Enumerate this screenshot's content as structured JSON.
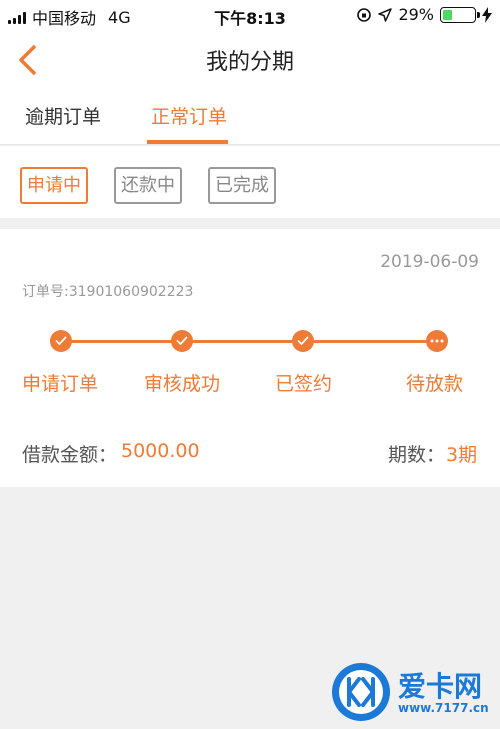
{
  "status_bar": {
    "carrier": "中国移动",
    "network": "4G",
    "time": "下午8:13",
    "battery_percent": "29%",
    "battery_level": 0.29,
    "battery_color": "#4cd964"
  },
  "nav": {
    "title": "我的分期",
    "back_icon": "chevron-left-icon"
  },
  "tabs": [
    {
      "label": "逾期订单",
      "active": false
    },
    {
      "label": "正常订单",
      "active": true
    }
  ],
  "filters": [
    {
      "label": "申请中",
      "active": true
    },
    {
      "label": "还款中",
      "active": false
    },
    {
      "label": "已完成",
      "active": false
    }
  ],
  "order": {
    "date": "2019-06-09",
    "order_no": "订单号:31901060902223",
    "steps": [
      {
        "label": "申请订单",
        "icon": "check-icon"
      },
      {
        "label": "审核成功",
        "icon": "check-icon"
      },
      {
        "label": "已签约",
        "icon": "check-icon"
      },
      {
        "label": "待放款",
        "icon": "more-dots-icon"
      }
    ],
    "amount_label": "借款金额：",
    "amount_value": "5000.00",
    "periods_label": "期数：",
    "periods_value": "3期"
  },
  "watermark": {
    "text": "爱卡网",
    "url": "www.7177.cn"
  },
  "colors": {
    "accent": "#ee7b36",
    "watermark_blue": "#1c7ad6"
  }
}
